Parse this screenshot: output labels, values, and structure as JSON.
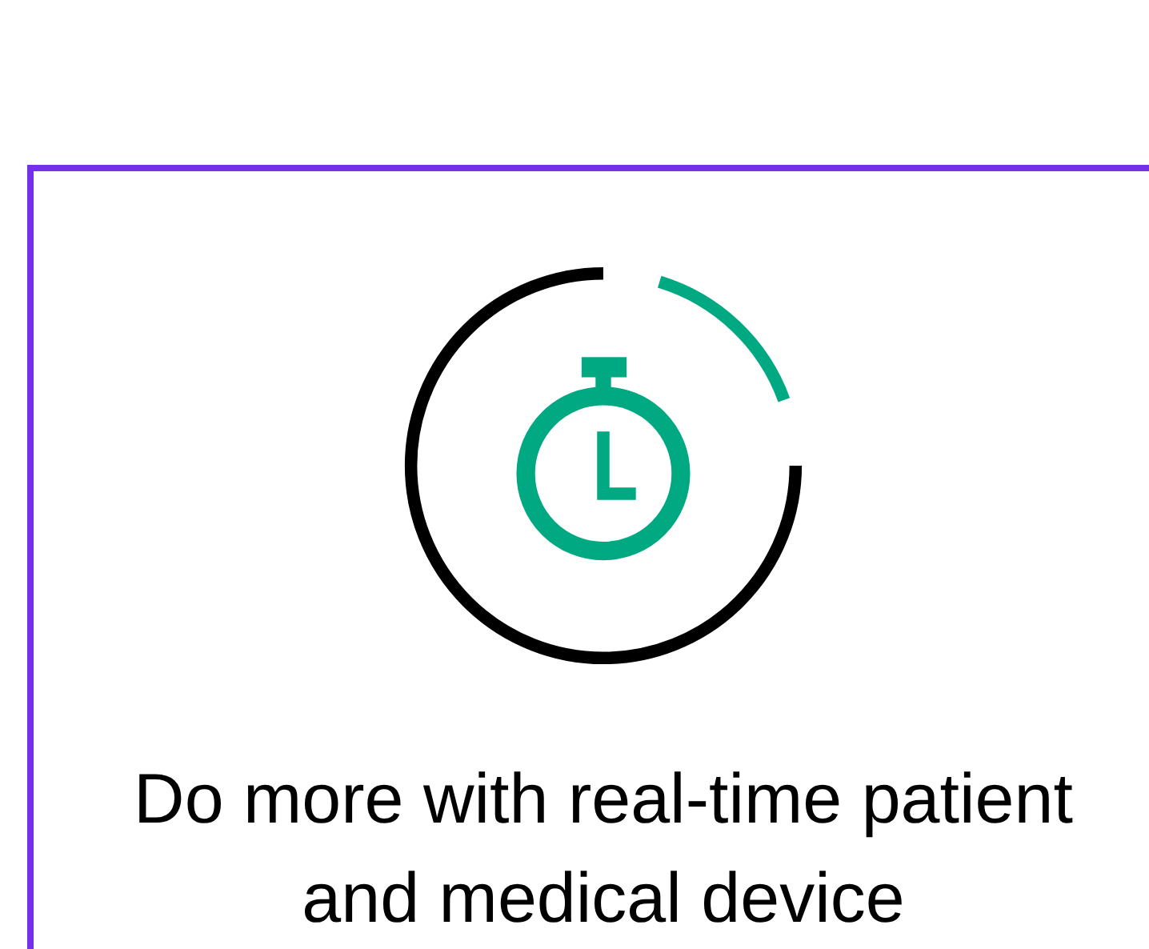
{
  "card": {
    "heading": "Do more with real-time patient and medical device"
  }
}
